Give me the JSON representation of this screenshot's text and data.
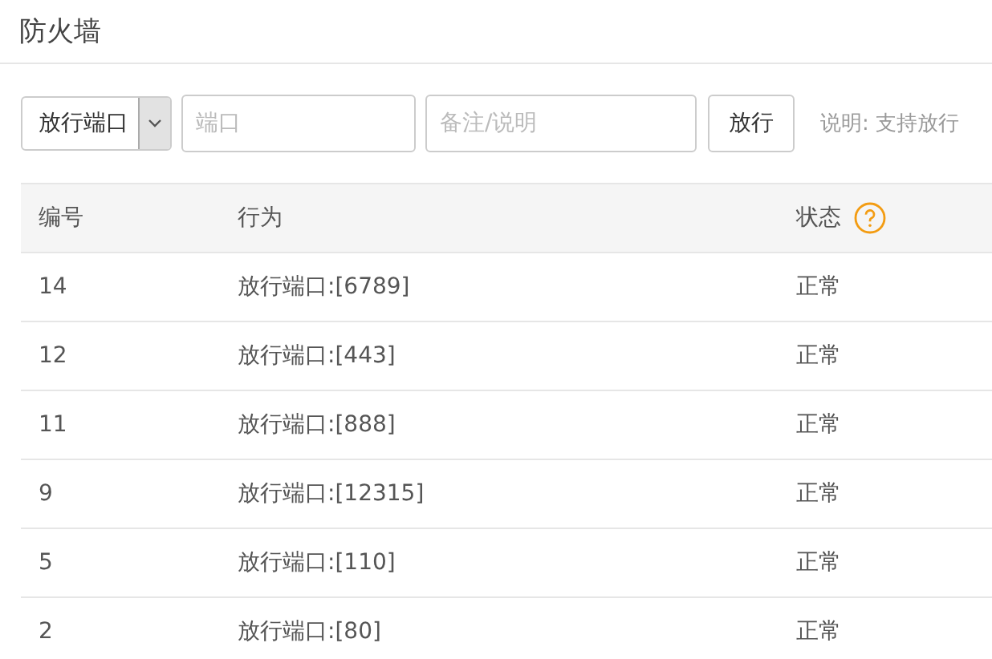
{
  "title": "防火墙",
  "toolbar": {
    "select": {
      "value": "放行端口"
    },
    "port_field": {
      "placeholder": "端口"
    },
    "note_field": {
      "placeholder": "备注/说明"
    },
    "submit": "放行",
    "hint": "说明: 支持放行"
  },
  "table": {
    "columns": [
      {
        "label": "编号"
      },
      {
        "label": "行为"
      },
      {
        "label": "状态",
        "help": true
      }
    ],
    "rows": [
      {
        "cells": [
          "14",
          "放行端口:[6789]",
          "正常"
        ]
      },
      {
        "cells": [
          "12",
          "放行端口:[443]",
          "正常"
        ]
      },
      {
        "cells": [
          "11",
          "放行端口:[888]",
          "正常"
        ]
      },
      {
        "cells": [
          "9",
          "放行端口:[12315]",
          "正常"
        ]
      },
      {
        "cells": [
          "5",
          "放行端口:[110]",
          "正常"
        ]
      },
      {
        "cells": [
          "2",
          "放行端口:[80]",
          "正常"
        ]
      }
    ]
  }
}
